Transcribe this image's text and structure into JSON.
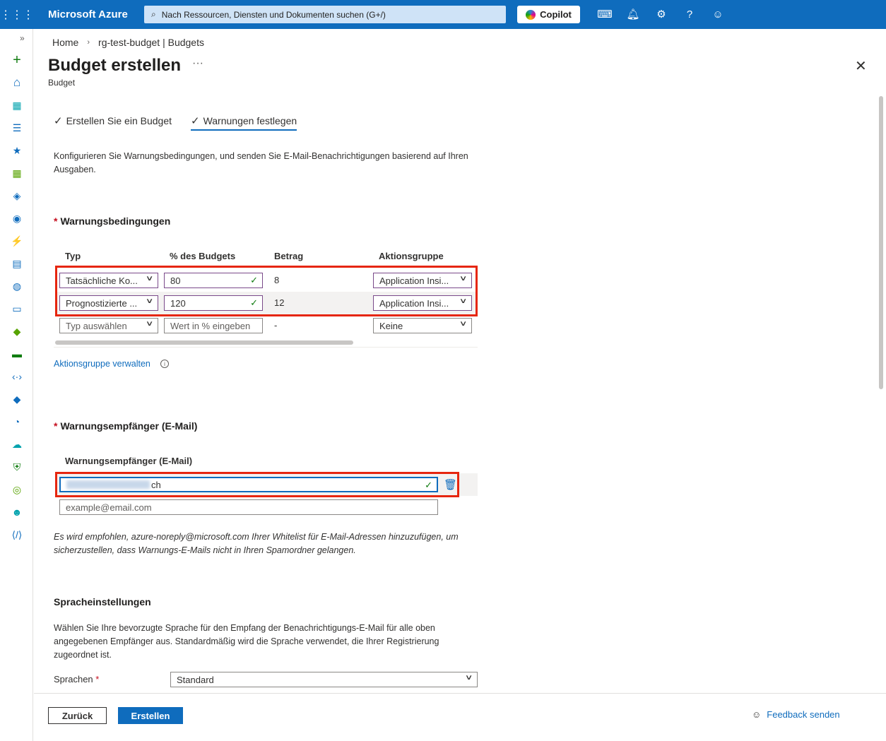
{
  "topbar": {
    "brand": "Microsoft Azure",
    "search_placeholder": "Nach Ressourcen, Diensten und Dokumenten suchen (G+/)",
    "copilot_label": "Copilot"
  },
  "breadcrumb": {
    "home": "Home",
    "current": "rg-test-budget | Budgets"
  },
  "page": {
    "title": "Budget erstellen",
    "more": "···",
    "subtitle": "Budget"
  },
  "tabs": [
    {
      "label": "Erstellen Sie ein Budget"
    },
    {
      "label": "Warnungen festlegen"
    }
  ],
  "intro_text": "Konfigurieren Sie Warnungsbedingungen, und senden Sie E-Mail-Benachrichtigungen basierend auf Ihren Ausgaben.",
  "conditions": {
    "title": "Warnungsbedingungen",
    "required_mark": "*",
    "headers": {
      "type": "Typ",
      "percent": "% des Budgets",
      "amount": "Betrag",
      "action_group": "Aktionsgruppe"
    },
    "rows": [
      {
        "type": "Tatsächliche Ko...",
        "percent": "80",
        "amount": "8",
        "action_group": "Application Insi..."
      },
      {
        "type": "Prognostizierte ...",
        "percent": "120",
        "amount": "12",
        "action_group": "Application Insi..."
      },
      {
        "type": "Typ auswählen",
        "percent_placeholder": "Wert in % eingeben",
        "amount": "-",
        "action_group": "Keine"
      }
    ],
    "manage_link": "Aktionsgruppe verwalten"
  },
  "recipients": {
    "title": "Warnungsempfänger (E-Mail)",
    "required_mark": "*",
    "column_header": "Warnungsempfänger (E-Mail)",
    "email_suffix": "ch",
    "new_placeholder": "example@email.com",
    "hint": "Es wird empfohlen, azure-noreply@microsoft.com Ihrer Whitelist für E-Mail-Adressen hinzuzufügen, um sicherzustellen, dass Warnungs-E-Mails nicht in Ihren Spamordner gelangen."
  },
  "language": {
    "title": "Spracheinstellungen",
    "description": "Wählen Sie Ihre bevorzugte Sprache für den Empfang der Benachrichtigungs-E-Mail für alle oben angegebenen Empfänger aus. Standardmäßig wird die Sprache verwendet, die Ihrer Registrierung zugeordnet ist.",
    "label": "Sprachen",
    "required_mark": "*",
    "value": "Standard"
  },
  "footer": {
    "back_label": "Zurück",
    "create_label": "Erstellen",
    "feedback_label": "Feedback senden"
  },
  "colors": {
    "azure_blue": "#0f6cbd",
    "highlight_red": "#e6260f",
    "valid_green": "#107c10"
  }
}
